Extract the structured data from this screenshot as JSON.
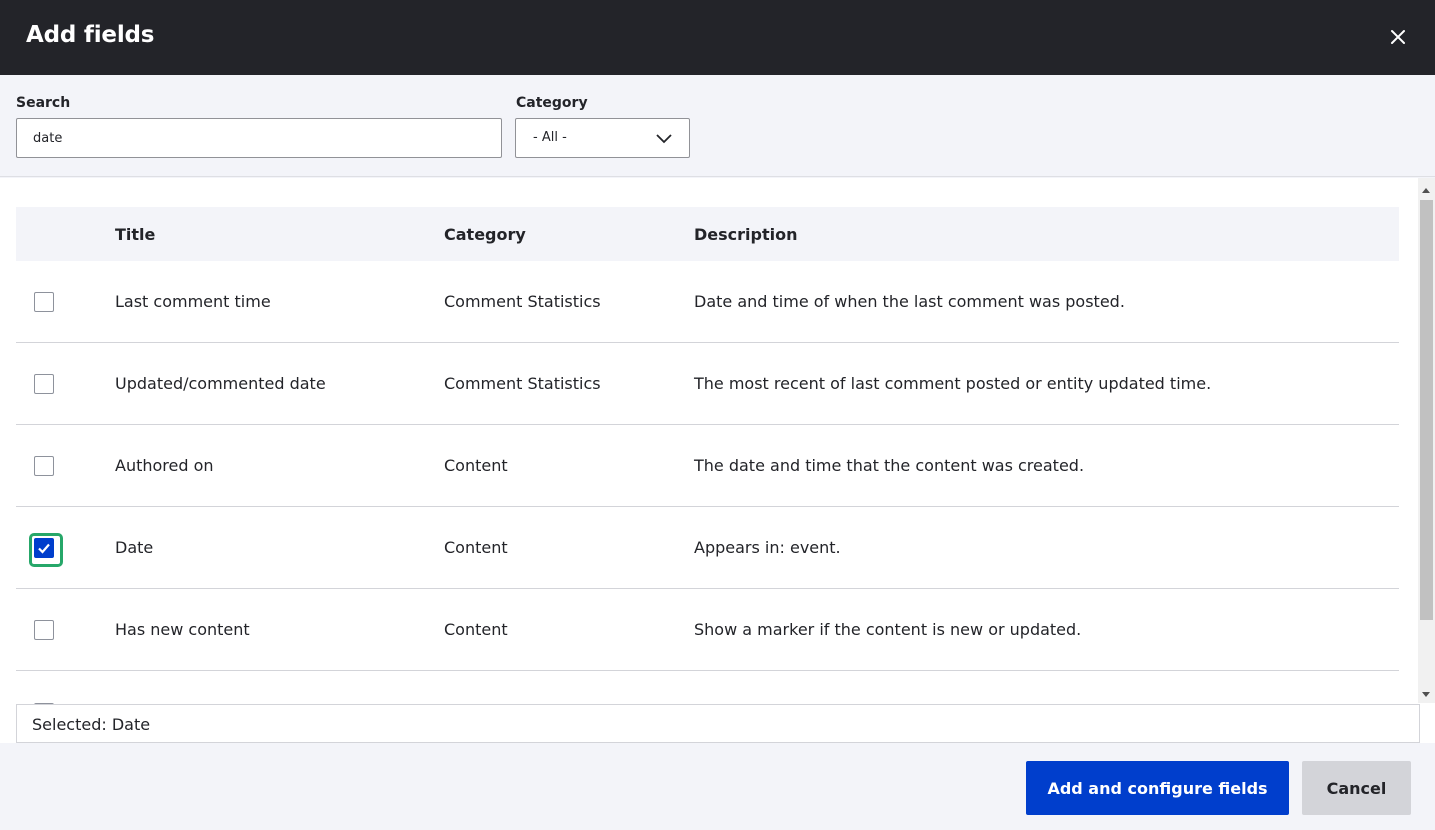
{
  "dialog": {
    "title": "Add fields",
    "close_icon": "close-icon"
  },
  "filters": {
    "search": {
      "label": "Search",
      "value": "date",
      "placeholder": ""
    },
    "category": {
      "label": "Category",
      "selected": "- All -"
    }
  },
  "table": {
    "headers": {
      "title": "Title",
      "category": "Category",
      "description": "Description"
    },
    "rows": [
      {
        "checked": false,
        "title": "Last comment time",
        "category": "Comment Statistics",
        "description": "Date and time of when the last comment was posted."
      },
      {
        "checked": false,
        "title": "Updated/commented date",
        "category": "Comment Statistics",
        "description": "The most recent of last comment posted or entity updated time."
      },
      {
        "checked": false,
        "title": "Authored on",
        "category": "Content",
        "description": "The date and time that the content was created."
      },
      {
        "checked": true,
        "title": "Date",
        "category": "Content",
        "description": "Appears in: event."
      },
      {
        "checked": false,
        "title": "Has new content",
        "category": "Content",
        "description": "Show a marker if the content is new or updated."
      }
    ]
  },
  "selected": {
    "text": "Selected: Date"
  },
  "footer": {
    "primary_label": "Add and configure fields",
    "cancel_label": "Cancel"
  },
  "colors": {
    "header_bg": "#232429",
    "primary": "#003ecc",
    "focus_ring": "#26a769"
  }
}
